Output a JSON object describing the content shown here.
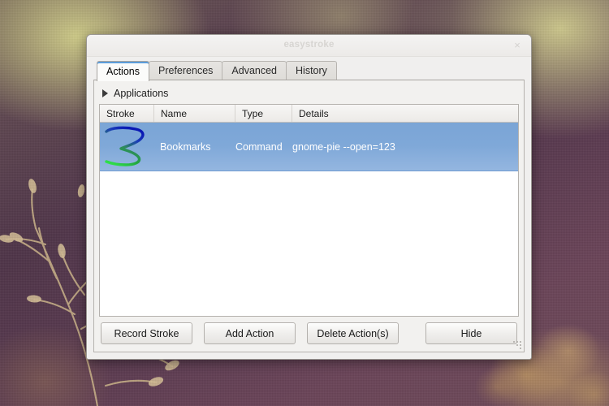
{
  "desktop": {
    "wallpaper_description": "blurred bokeh photograph with dried plant silhouette",
    "colors": {
      "background_purple": "#5d4550",
      "bokeh_gold": "#d6b068",
      "glow_olive": "#d6d48c"
    }
  },
  "window": {
    "title": "easystroke",
    "close_label": "×",
    "close_icon": "close-icon",
    "resize_grip_icon": "resize-grip-icon"
  },
  "tabs": [
    {
      "label": "Actions",
      "active": true
    },
    {
      "label": "Preferences",
      "active": false
    },
    {
      "label": "Advanced",
      "active": false
    },
    {
      "label": "History",
      "active": false
    }
  ],
  "expander": {
    "label": "Applications",
    "icon": "triangle-right-icon",
    "expanded": false
  },
  "table": {
    "columns": [
      "Stroke",
      "Name",
      "Type",
      "Details"
    ],
    "rows": [
      {
        "stroke_icon": "gesture-stroke-icon",
        "stroke_description": "three-shaped gesture, blue to green gradient",
        "name": "Bookmarks",
        "type": "Command",
        "details": "gnome-pie --open=123",
        "selected": true
      }
    ],
    "selection_color": "#7fa8d8"
  },
  "buttons": {
    "record_stroke": "Record Stroke",
    "add_action": "Add Action",
    "delete_actions": "Delete Action(s)",
    "hide": "Hide"
  }
}
